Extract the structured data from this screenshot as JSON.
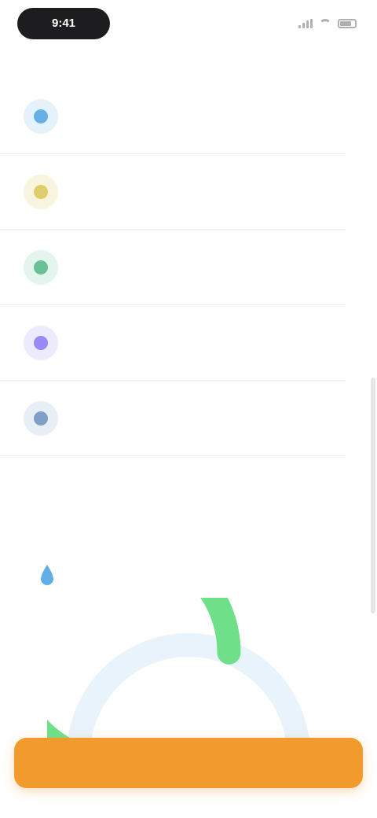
{
  "status_bar": {
    "time": "9:41"
  },
  "list": {
    "section_label": "",
    "items": [
      {
        "label": "",
        "icon": "blue-circle-icon",
        "color": "#3b9ae0",
        "bg": "#e6f2fb"
      },
      {
        "label": "",
        "icon": "yellow-circle-icon",
        "color": "#d8c04a",
        "bg": "#f8f4dd"
      },
      {
        "label": "",
        "icon": "green-circle-icon",
        "color": "#3fb07a",
        "bg": "#e3f5ec"
      },
      {
        "label": "",
        "icon": "purple-circle-icon",
        "color": "#7a6af0",
        "bg": "#ecebfd"
      },
      {
        "label": "",
        "icon": "slate-circle-icon",
        "color": "#5b86b8",
        "bg": "#e8eef6"
      }
    ]
  },
  "section": {
    "title": "",
    "description": "",
    "detail": {
      "line1": "",
      "line2": "",
      "icon": "drop-icon",
      "color": "#3b9ae0"
    }
  },
  "gauge": {
    "caption": "",
    "value_fraction": 0.62,
    "fill_color": "#6fe08a",
    "track_color": "#e9f3fb"
  },
  "cta": {
    "label": "",
    "color": "#f19a2e"
  }
}
